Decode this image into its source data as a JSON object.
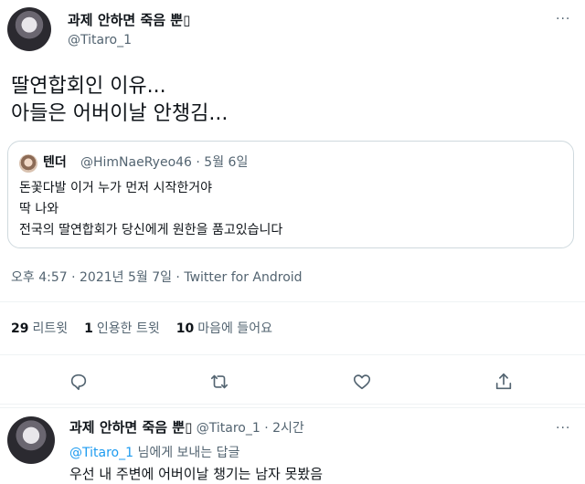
{
  "tweet": {
    "author_name": "과제 안하면 죽음 뿐▯",
    "author_handle": "@Titaro_1",
    "more": "···",
    "text_line1": "딸연합회인 이유...",
    "text_line2": "아들은 어버이날 안챙김...",
    "timestamp": "오후 4:57 · 2021년 5월 7일 · Twitter for Android"
  },
  "quote": {
    "author_name": "텐더",
    "meta": "@HimNaeRyeo46 · 5월 6일",
    "line1": "돈꽃다발 이거 누가 먼저 시작한거야",
    "line2": "딱 나와",
    "line3": "전국의 딸연합회가 당신에게 원한을 품고있습니다"
  },
  "stats": {
    "retweets_count": "29",
    "retweets_label": "리트윗",
    "quotes_count": "1",
    "quotes_label": "인용한 트윗",
    "likes_count": "10",
    "likes_label": "마음에 들어요"
  },
  "actions": [
    "reply-icon",
    "retweet-icon",
    "like-icon",
    "share-icon"
  ],
  "reply": {
    "author_name": "과제 안하면 죽음 뿐▯",
    "meta": "@Titaro_1 · 2시간",
    "more": "···",
    "replying_mention": "@Titaro_1",
    "replying_suffix": " 님에게 보내는 답글",
    "text": "우선 내 주변에 어버이날 챙기는 남자 못봤음"
  },
  "colors": {
    "accent": "#1d9bf0",
    "secondary_text": "#536471",
    "border": "#cfd9de"
  }
}
